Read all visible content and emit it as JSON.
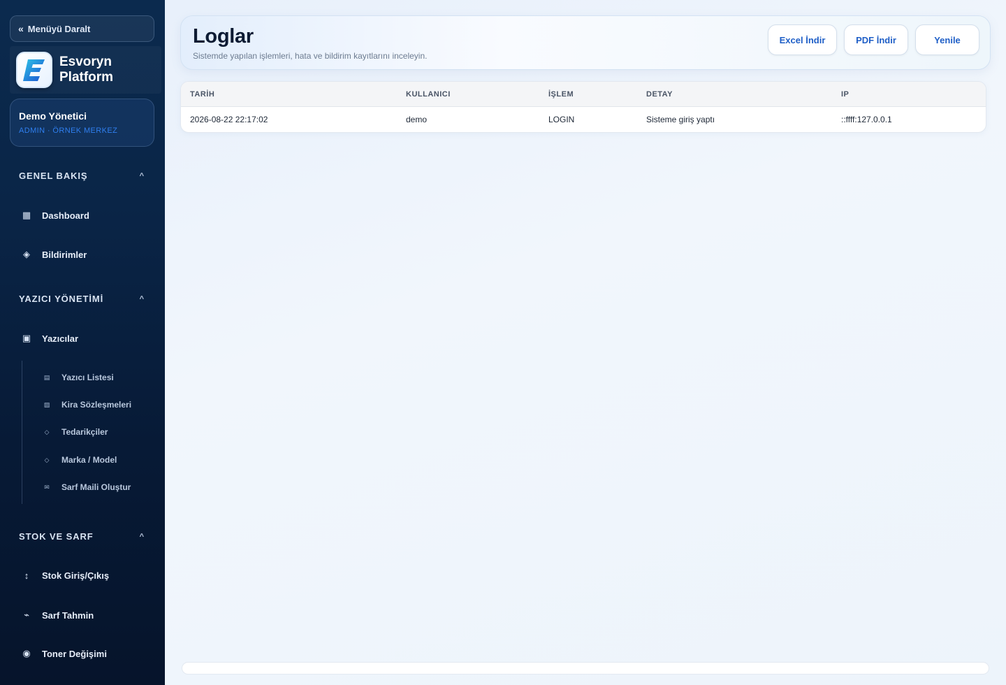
{
  "sidebar": {
    "collapse_label": "Menüyü Daralt",
    "brand": {
      "line1": "Esvoryn",
      "line2": "Platform"
    },
    "user": {
      "name": "Demo Yönetici",
      "role": "ADMIN · ÖRNEK MERKEZ"
    },
    "sections": [
      {
        "title": "GENEL BAKIŞ",
        "items": [
          {
            "label": "Dashboard",
            "icon": "grid-icon"
          },
          {
            "label": "Bildirimler",
            "icon": "diamond-icon"
          }
        ]
      },
      {
        "title": "YAZICI YÖNETİMİ",
        "items": [
          {
            "label": "Yazıcılar",
            "icon": "printer-icon"
          }
        ],
        "subitems": [
          {
            "label": "Yazıcı Listesi",
            "icon": "list-icon"
          },
          {
            "label": "Kira Sözleşmeleri",
            "icon": "contract-icon"
          },
          {
            "label": "Tedarikçiler",
            "icon": "diamond-small-icon"
          },
          {
            "label": "Marka / Model",
            "icon": "diamond-small-icon"
          },
          {
            "label": "Sarf Maili Oluştur",
            "icon": "mail-icon"
          }
        ]
      },
      {
        "title": "STOK VE SARF",
        "items": [
          {
            "label": "Stok Giriş/Çıkış",
            "icon": "arrows-vertical-icon"
          },
          {
            "label": "Sarf Tahmin",
            "icon": "trend-icon"
          },
          {
            "label": "Toner Değişimi",
            "icon": "radio-icon"
          }
        ]
      }
    ]
  },
  "header": {
    "title": "Loglar",
    "subtitle": "Sistemde yapılan işlemleri, hata ve bildirim kayıtlarını inceleyin.",
    "buttons": {
      "excel": "Excel İndir",
      "pdf": "PDF İndir",
      "refresh": "Yenile"
    }
  },
  "table": {
    "columns": [
      "TARİH",
      "KULLANICI",
      "İŞLEM",
      "DETAY",
      "IP"
    ],
    "rows": [
      [
        "2026-08-22 22:17:02",
        "demo",
        "LOGIN",
        "Sisteme giriş yaptı",
        "::ffff:127.0.0.1"
      ]
    ]
  },
  "colors": {
    "sidebar": "#0a2547",
    "accent": "#1f5fc7",
    "role": "#2f7ff0"
  }
}
